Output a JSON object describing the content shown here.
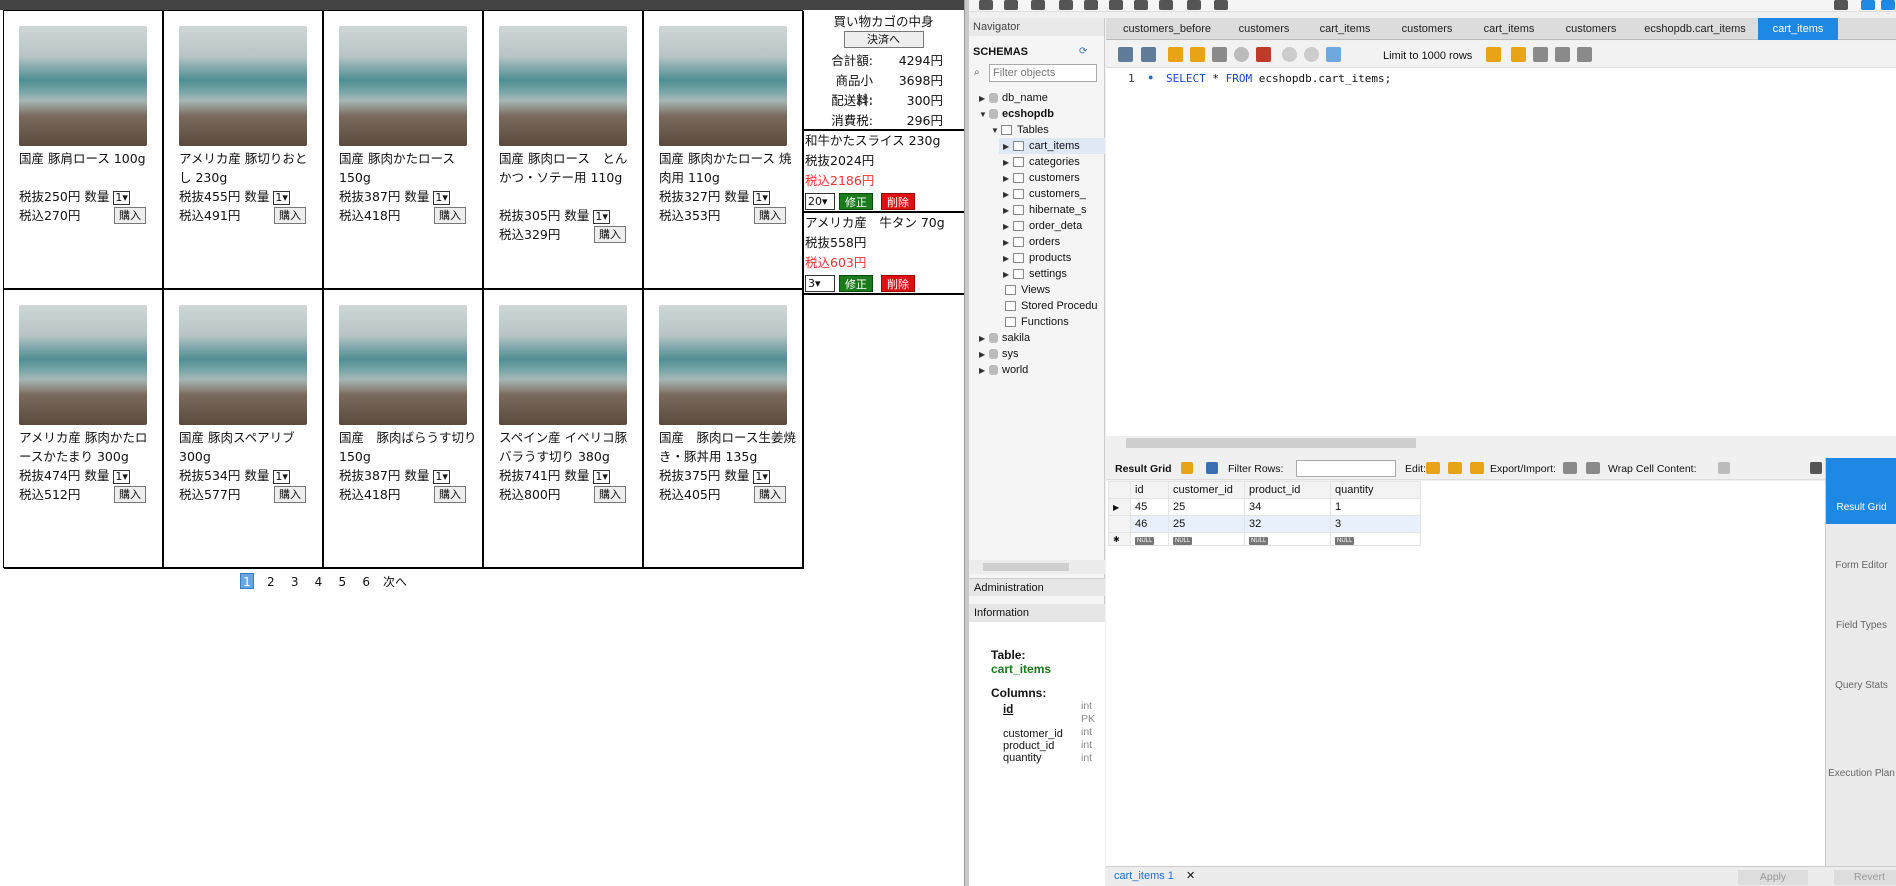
{
  "shop": {
    "products": [
      {
        "name": "国産 豚肩ロース 100g",
        "ex": "税抜250円",
        "inc": "税込270円",
        "qty": "1"
      },
      {
        "name": "アメリカ産 豚切りおとし 230g",
        "ex": "税抜455円",
        "inc": "税込491円",
        "qty": "1"
      },
      {
        "name": "国産 豚肉かたロース 150g",
        "ex": "税抜387円",
        "inc": "税込418円",
        "qty": "1"
      },
      {
        "name": "国産 豚肉ロース　とんかつ・ソテー用 110g",
        "ex": "税抜305円",
        "inc": "税込329円",
        "qty": "1"
      },
      {
        "name": "国産 豚肉かたロース 焼肉用 110g",
        "ex": "税抜327円",
        "inc": "税込353円",
        "qty": "1"
      },
      {
        "name": "アメリカ産 豚肉かたロースかたまり 300g",
        "ex": "税抜474円",
        "inc": "税込512円",
        "qty": "1"
      },
      {
        "name": "国産 豚肉スペアリブ 300g",
        "ex": "税抜534円",
        "inc": "税込577円",
        "qty": "1"
      },
      {
        "name": "国産　豚肉ばらうす切り 150g",
        "ex": "税抜387円",
        "inc": "税込418円",
        "qty": "1"
      },
      {
        "name": "スペイン産 イベリコ豚バラうす切り 380g",
        "ex": "税抜741円",
        "inc": "税込800円",
        "qty": "1"
      },
      {
        "name": "国産　豚肉ロース生姜焼き・豚丼用 135g",
        "ex": "税抜375円",
        "inc": "税込405円",
        "qty": "1"
      }
    ],
    "qty_label": "数量",
    "buy_label": "購入",
    "cart": {
      "title": "買い物カゴの中身",
      "checkout": "決済へ",
      "total_label": "合計額:",
      "total": "4294円",
      "subtotal_label": "商品小計:",
      "subtotal": "3698円",
      "shipping_label": "配送料:",
      "shipping": "300円",
      "tax_label": "消費税:",
      "tax": "296円",
      "items": [
        {
          "name": "和牛かたスライス 230g",
          "ex": "税抜2024円",
          "inc": "税込2186円",
          "qty": "20"
        },
        {
          "name": "アメリカ産　牛タン 70g",
          "ex": "税抜558円",
          "inc": "税込603円",
          "qty": "3"
        }
      ],
      "fix_label": "修正",
      "del_label": "削除"
    },
    "pager": {
      "pages": [
        "1",
        "2",
        "3",
        "4",
        "5",
        "6"
      ],
      "next": "次へ",
      "current": "1"
    }
  },
  "workbench": {
    "navigator_title": "Navigator",
    "schemas_label": "SCHEMAS",
    "filter_placeholder": "Filter objects",
    "tree": {
      "db_name": "db_name",
      "ecshopdb": "ecshopdb",
      "tables": "Tables",
      "table_list": [
        "cart_items",
        "categories",
        "customers",
        "customers_",
        "hibernate_s",
        "order_deta",
        "orders",
        "products",
        "settings"
      ],
      "views": "Views",
      "procs": "Stored Procedu",
      "functions": "Functions",
      "other_dbs": [
        "sakila",
        "sys",
        "world"
      ]
    },
    "admin_label": "Administration",
    "info_label": "Information",
    "info": {
      "table_label": "Table:",
      "table_name": "cart_items",
      "columns_label": "Columns:",
      "cols": [
        {
          "name": "id",
          "type": "int",
          "extra": "PK"
        },
        {
          "name": "customer_id",
          "type": "int"
        },
        {
          "name": "product_id",
          "type": "int"
        },
        {
          "name": "quantity",
          "type": "int"
        }
      ]
    },
    "tabs": [
      "customers_before",
      "customers",
      "cart_items",
      "customers",
      "cart_items",
      "customers",
      "ecshopdb.cart_items",
      "cart_items"
    ],
    "limit_label": "Limit to 1000 rows",
    "sql": {
      "line": "1",
      "kw1": "SELECT",
      "rest1": " * ",
      "kw2": "FROM",
      "rest2": " ecshopdb.cart_items;"
    },
    "result": {
      "result_grid": "Result Grid",
      "filter_rows": "Filter Rows:",
      "edit": "Edit:",
      "export": "Export/Import:",
      "wrap": "Wrap Cell Content:",
      "headers": [
        "id",
        "customer_id",
        "product_id",
        "quantity"
      ],
      "rows": [
        [
          "45",
          "25",
          "34",
          "1"
        ],
        [
          "46",
          "25",
          "32",
          "3"
        ]
      ],
      "null": "NULL"
    },
    "side": {
      "result_grid": "Result Grid",
      "form": "Form Editor",
      "field": "Field Types",
      "query": "Query Stats",
      "exec": "Execution Plan"
    },
    "bottom_tab": "cart_items 1",
    "apply": "Apply",
    "revert": "Revert"
  }
}
